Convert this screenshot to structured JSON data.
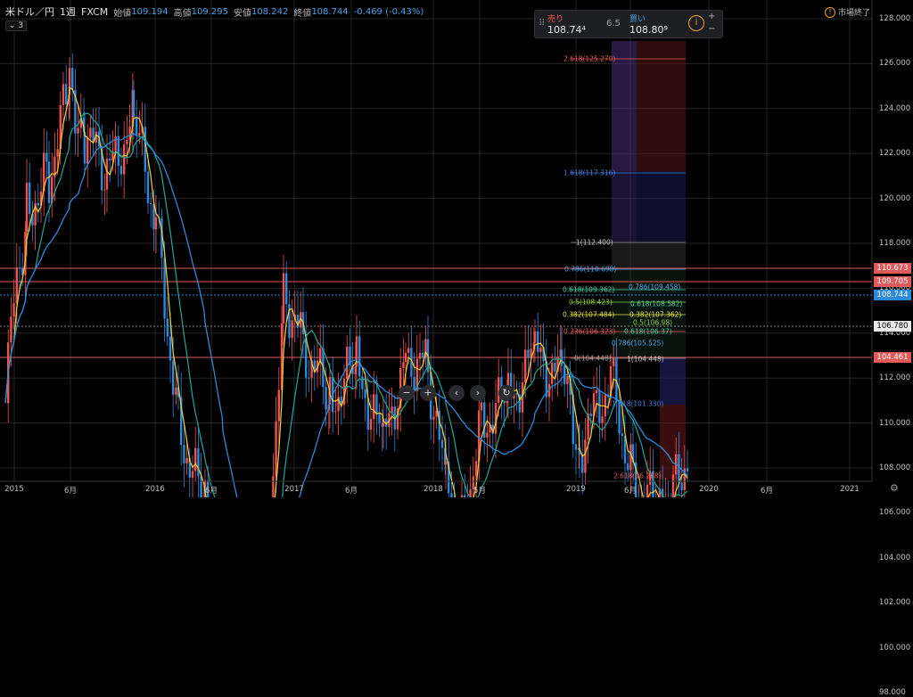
{
  "header": {
    "symbol": "米ドル／円",
    "interval": "1週",
    "source": "FXCM",
    "open_label": "始値",
    "open": "109.194",
    "high_label": "高値",
    "high": "109.295",
    "low_label": "安値",
    "low": "108.242",
    "close_label": "終値",
    "close": "108.744",
    "change": "-0.469 (-0.43%)",
    "indicator_count": "3"
  },
  "trade": {
    "sell_label": "売り",
    "sell_price": "108.74⁴",
    "spread": "6.5",
    "buy_label": "買い",
    "buy_price": "108.80⁹",
    "plus": "+",
    "minus": "−"
  },
  "market_status": "市場終了",
  "y_ticks": [
    "128.000",
    "126.000",
    "124.000",
    "122.000",
    "120.000",
    "118.000",
    "116.000",
    "114.000",
    "112.000",
    "110.000",
    "108.000",
    "106.000",
    "104.000",
    "102.000",
    "100.000",
    "98.000"
  ],
  "y_labels": [
    {
      "text": "110.673",
      "color": "#e05a5a"
    },
    {
      "text": "109.705",
      "color": "#e05a5a"
    },
    {
      "text": "108.744",
      "color": "#2e8ad8"
    },
    {
      "text": "106.780",
      "color": "#e8e8e8"
    },
    {
      "text": "104.461",
      "color": "#e05a5a"
    }
  ],
  "x_ticks": [
    "2015",
    "6月",
    "2016",
    "6月",
    "2017",
    "6月",
    "2018",
    "5月",
    "2019",
    "6月",
    "2020",
    "6月",
    "2021"
  ],
  "fib_top": [
    {
      "text": "2.618(125.270)",
      "color": "#e05a5a"
    },
    {
      "text": "1.618(117.316)",
      "color": "#4a7ae0"
    },
    {
      "text": "1(112.400)",
      "color": "#c8c8c8"
    },
    {
      "text": "0.786(110.698)",
      "color": "#4aa3e8"
    },
    {
      "text": "0.618(109.362)",
      "color": "#40d0a0"
    },
    {
      "text": "0.5(108.423)",
      "color": "#8ad040"
    },
    {
      "text": "0.382(107.484)",
      "color": "#e0e040"
    },
    {
      "text": "0.236(106.323)",
      "color": "#e05a5a"
    },
    {
      "text": "0(104.448)",
      "color": "#a0a0a0"
    }
  ],
  "fib_bottom": [
    {
      "text": "0.786(109.458)",
      "color": "#4aa3e8"
    },
    {
      "text": "0.618(108.582)",
      "color": "#40d0a0"
    },
    {
      "text": "0.382(107.362)",
      "color": "#e0e040"
    },
    {
      "text": "0.5(106.98)",
      "color": "#8ad040"
    },
    {
      "text": "0.618(106.37)",
      "color": "#40d0a0"
    },
    {
      "text": "0.786(105.525)",
      "color": "#4aa3e8"
    },
    {
      "text": "1(104.448)",
      "color": "#c8c8c8"
    },
    {
      "text": "1.618(101.330)",
      "color": "#4a7ae0"
    },
    {
      "text": "2.618(96.288)",
      "color": "#e05a5a"
    }
  ],
  "nav": {
    "zoom_out": "−",
    "zoom_in": "+",
    "back": "‹",
    "forward": "›",
    "reset": "↻"
  },
  "colors": {
    "up": "#ef5350",
    "down": "#2e8ad8",
    "ma_fast": "#f2d13a",
    "ma_mid": "#26a69a",
    "ma_slow": "#2e8ad8",
    "hline": "#e05a5a"
  }
}
